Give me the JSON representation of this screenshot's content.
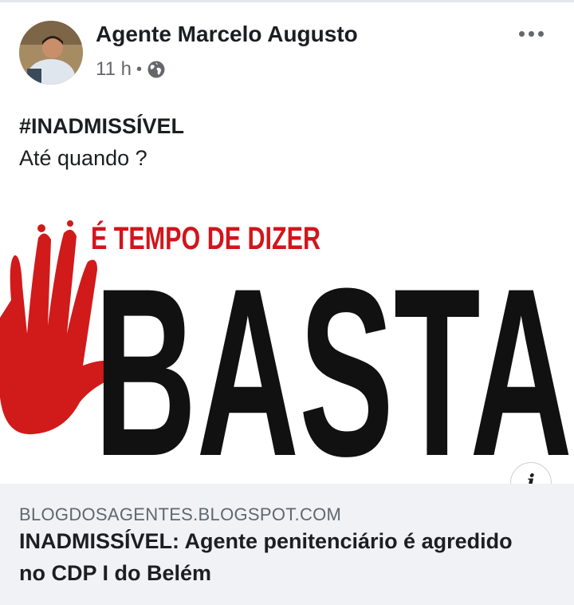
{
  "post": {
    "author": "Agente Marcelo Augusto",
    "time": "11 h",
    "separator": "•",
    "privacy_icon": "globe-icon",
    "menu_icon": "more-horizontal-icon",
    "hashtag": "#INADMISSÍVEL",
    "text": "Até quando ?"
  },
  "link_preview": {
    "image_headline": "É TEMPO DE DIZER",
    "image_word": "BASTA",
    "info_icon_glyph": "i",
    "domain": "BLOGDOSAGENTES.BLOGSPOT.COM",
    "title": "INADMISSÍVEL: Agente penitenciário é agredido no CDP I do Belém"
  },
  "colors": {
    "text_primary": "#1c1e21",
    "text_secondary": "#65676b",
    "caption_bg": "#f0f2f5",
    "headline_red": "#d0161b",
    "hand_red": "#d11a1a",
    "basta_black": "#111111"
  }
}
